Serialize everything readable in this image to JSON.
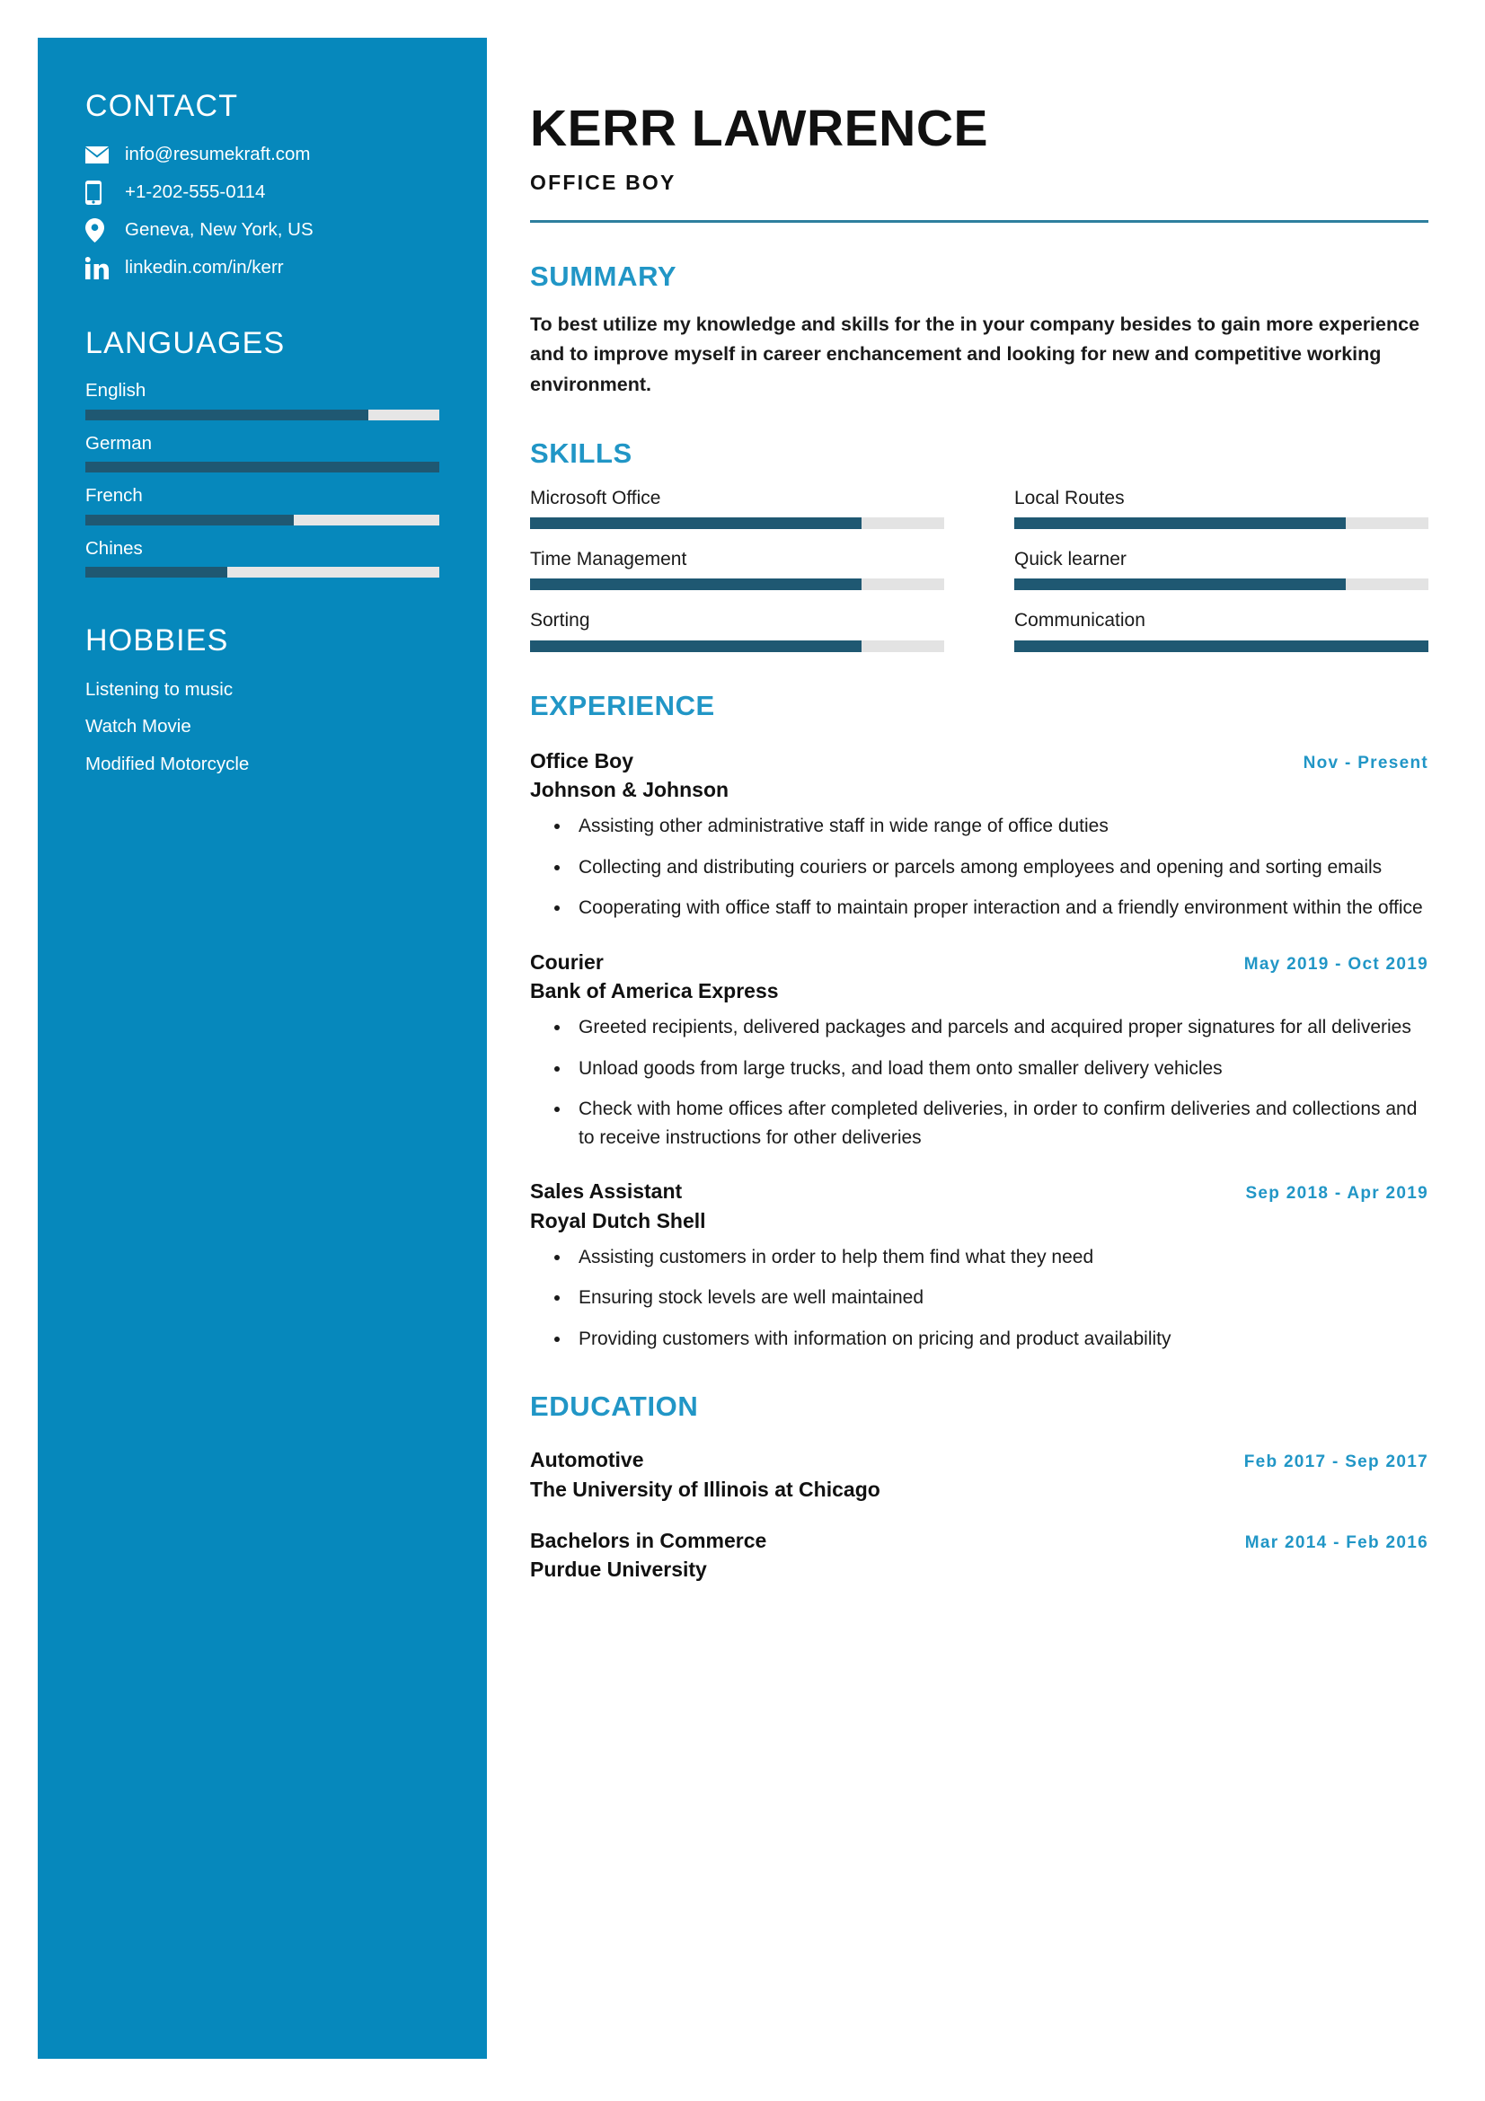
{
  "colors": {
    "sidebar_bg": "#0688bc",
    "accent": "#2196c6",
    "bar_fill": "#1f5872",
    "bar_track": "#e3e3e3",
    "rule": "#2e7f9e"
  },
  "sidebar": {
    "contact": {
      "heading": "CONTACT",
      "items": [
        {
          "icon": "email-icon",
          "text": "info@resumekraft.com"
        },
        {
          "icon": "phone-icon",
          "text": "+1-202-555-0114"
        },
        {
          "icon": "location-pin-icon",
          "text": "Geneva, New York, US"
        },
        {
          "icon": "linkedin-icon",
          "text": "linkedin.com/in/kerr"
        }
      ]
    },
    "languages": {
      "heading": "LANGUAGES",
      "items": [
        {
          "name": "English",
          "level": 80
        },
        {
          "name": "German",
          "level": 100
        },
        {
          "name": "French",
          "level": 59
        },
        {
          "name": "Chines",
          "level": 40
        }
      ]
    },
    "hobbies": {
      "heading": "HOBBIES",
      "items": [
        {
          "name": "Listening to music"
        },
        {
          "name": "Watch Movie"
        },
        {
          "name": "Modified Motorcycle"
        }
      ]
    }
  },
  "header": {
    "name": "KERR LAWRENCE",
    "title": "OFFICE BOY"
  },
  "summary": {
    "heading": "SUMMARY",
    "text": "To best utilize my knowledge and skills for the in your company besides to gain more experience and to improve myself in career enchancement and looking for new and competitive working environment."
  },
  "skills": {
    "heading": "SKILLS",
    "items": [
      {
        "name": "Microsoft Office",
        "level": 80
      },
      {
        "name": "Local Routes",
        "level": 80
      },
      {
        "name": "Time Management",
        "level": 80
      },
      {
        "name": "Quick learner",
        "level": 80
      },
      {
        "name": "Sorting",
        "level": 80
      },
      {
        "name": "Communication",
        "level": 100
      }
    ]
  },
  "experience": {
    "heading": "EXPERIENCE",
    "items": [
      {
        "role": "Office Boy",
        "date": "Nov - Present",
        "company": "Johnson & Johnson",
        "bullets": [
          "Assisting other administrative staff in wide range of office duties",
          "Collecting and distributing couriers or parcels among employees and opening and sorting emails",
          "Cooperating with office staff to maintain proper interaction and a friendly environment within the office"
        ]
      },
      {
        "role": "Courier",
        "date": "May 2019 - Oct 2019",
        "company": "Bank of America Express",
        "bullets": [
          "Greeted recipients, delivered packages and parcels and acquired proper signatures for all deliveries",
          "Unload goods from large trucks, and load them onto smaller delivery vehicles",
          "Check with home offices after completed deliveries, in order to confirm deliveries and collections and to receive instructions for other deliveries"
        ]
      },
      {
        "role": "Sales Assistant",
        "date": "Sep 2018 - Apr 2019",
        "company": "Royal Dutch Shell",
        "bullets": [
          "Assisting customers in order to help them find what they need",
          "Ensuring stock levels are well maintained",
          "Providing customers with information on pricing and product availability"
        ]
      }
    ]
  },
  "education": {
    "heading": "EDUCATION",
    "items": [
      {
        "degree": "Automotive",
        "date": "Feb 2017 - Sep 2017",
        "school": "The University of Illinois at Chicago"
      },
      {
        "degree": "Bachelors in Commerce",
        "date": "Mar 2014 - Feb 2016",
        "school": "Purdue University"
      }
    ]
  }
}
